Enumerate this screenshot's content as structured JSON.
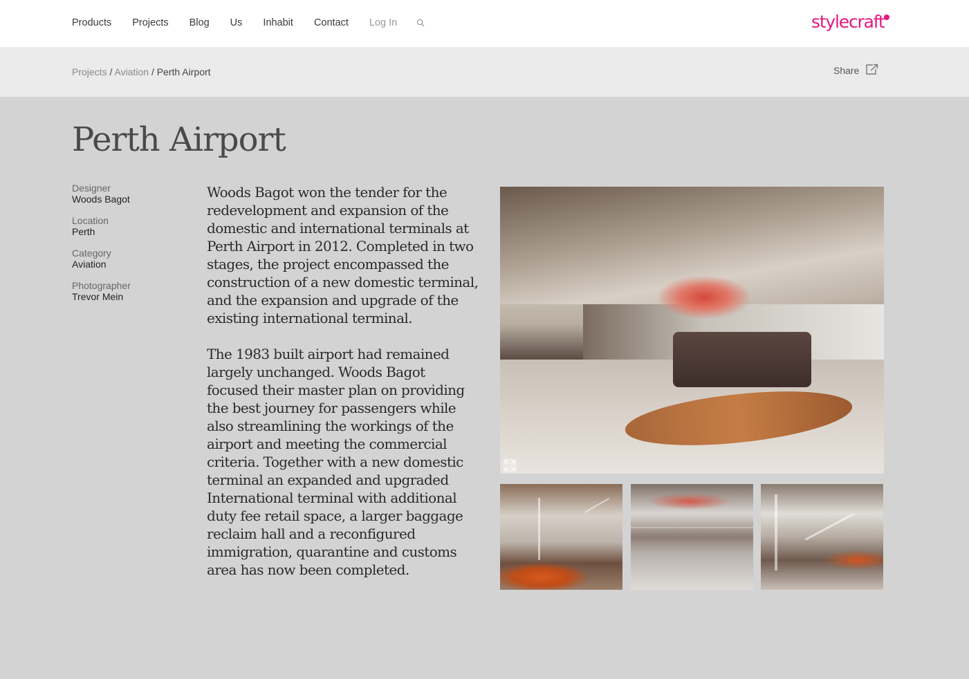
{
  "nav": {
    "items": [
      {
        "label": "Products"
      },
      {
        "label": "Projects"
      },
      {
        "label": "Blog"
      },
      {
        "label": "Us"
      },
      {
        "label": "Inhabit"
      },
      {
        "label": "Contact"
      }
    ],
    "login_label": "Log In",
    "search_icon": "search-icon"
  },
  "logo": {
    "text": "stylecraft",
    "color": "#e6177f"
  },
  "breadcrumb": {
    "items": [
      "Projects",
      "Aviation"
    ],
    "current": "Perth Airport",
    "separator": "/"
  },
  "share": {
    "label": "Share",
    "icon": "share-icon"
  },
  "project": {
    "title": "Perth Airport",
    "meta": [
      {
        "label": "Designer",
        "value": "Woods Bagot"
      },
      {
        "label": "Location",
        "value": "Perth"
      },
      {
        "label": "Category",
        "value": "Aviation"
      },
      {
        "label": "Photographer",
        "value": "Trevor Mein"
      }
    ],
    "description": [
      "Woods Bagot won the tender for the redevelopment and expansion of the domestic and international terminals at Perth Airport in 2012. Completed in two stages, the project encompassed the construction of a new domestic terminal, and the expansion and upgrade of the existing international terminal.",
      "The 1983 built airport had remained largely unchanged. Woods Bagot focused their master plan on providing the best journey for passengers while also streamlining the workings of the airport and meeting the commercial criteria. Together with a new domestic terminal an expanded and upgraded International terminal with additional duty fee retail space, a larger baggage reclaim hall and a reconfigured immigration, quarantine and customs area has now been completed."
    ]
  },
  "gallery": {
    "expand_icon": "expand-icon"
  },
  "colors": {
    "accent": "#e6177f",
    "page_background": "#d3d3d3",
    "breadcrumb_background": "#ebebeb"
  }
}
